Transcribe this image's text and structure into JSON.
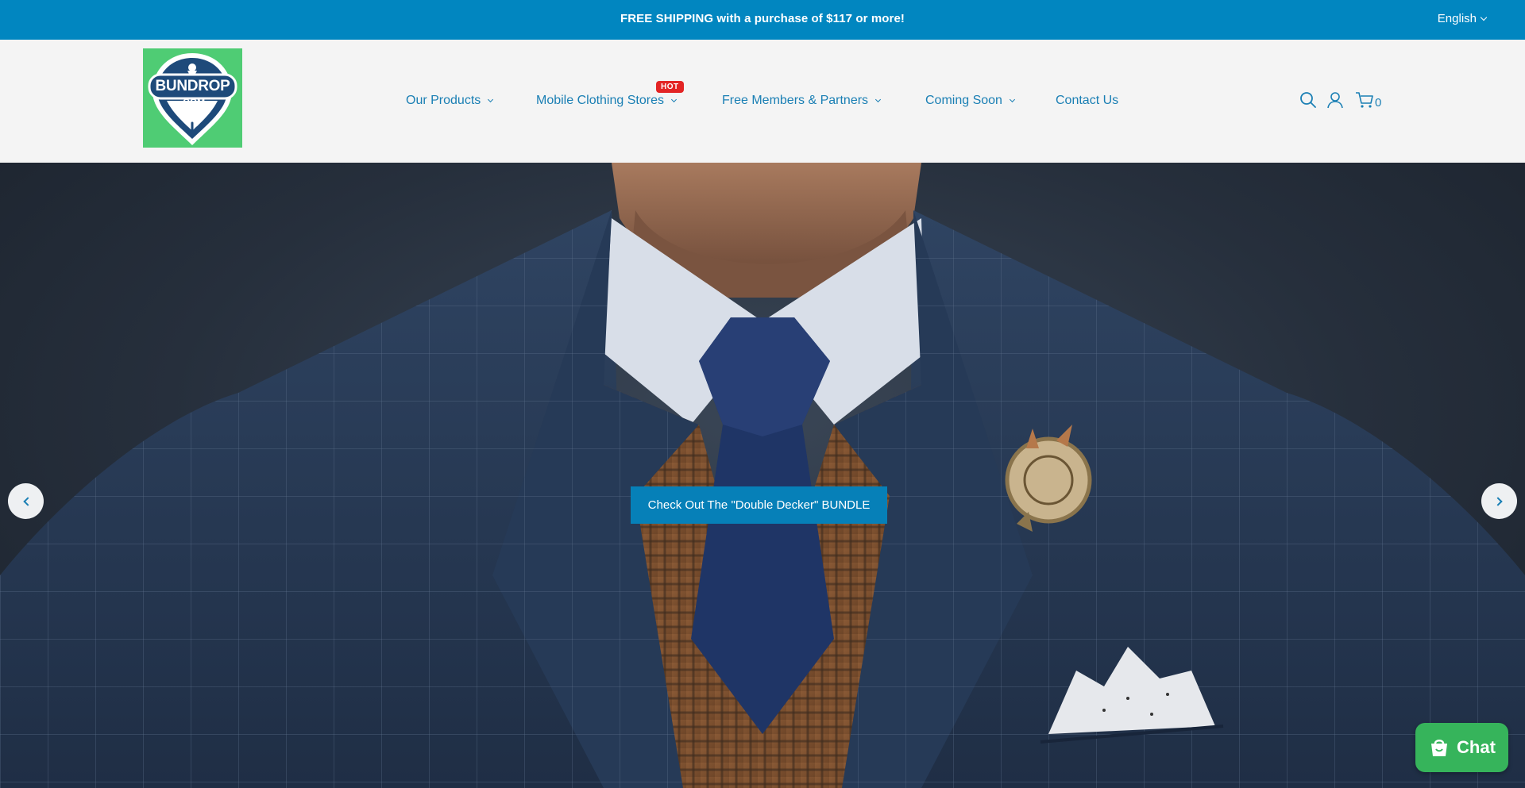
{
  "announcement": {
    "message": "FREE SHIPPING with a purchase of $117 or more!",
    "language": "English"
  },
  "logo": {
    "line1": "BUNDROP",
    "line2": ".COM",
    "bg_color": "#4fcc74"
  },
  "nav": {
    "items": [
      {
        "label": "Our Products",
        "has_dropdown": true
      },
      {
        "label": "Mobile Clothing Stores",
        "has_dropdown": true
      },
      {
        "label": "Free Members & Partners",
        "has_dropdown": true
      },
      {
        "label": "Coming Soon",
        "has_dropdown": true
      },
      {
        "label": "Contact Us",
        "has_dropdown": false
      }
    ],
    "hot_badge": "HOT"
  },
  "header_icons": {
    "search": "search-icon",
    "account": "user-icon",
    "cart": "cart-icon",
    "cart_count": "0"
  },
  "hero": {
    "cta_label": "Check Out The \"Double Decker\" BUNDLE",
    "prev_icon": "chevron-left-icon",
    "next_icon": "chevron-right-icon"
  },
  "chat": {
    "label": "Chat",
    "icon": "chat-bag-icon"
  },
  "colors": {
    "brand_blue": "#0186c0",
    "nav_text": "#1a7fb4",
    "hot_red": "#e32424",
    "chat_green": "#36b45b"
  }
}
